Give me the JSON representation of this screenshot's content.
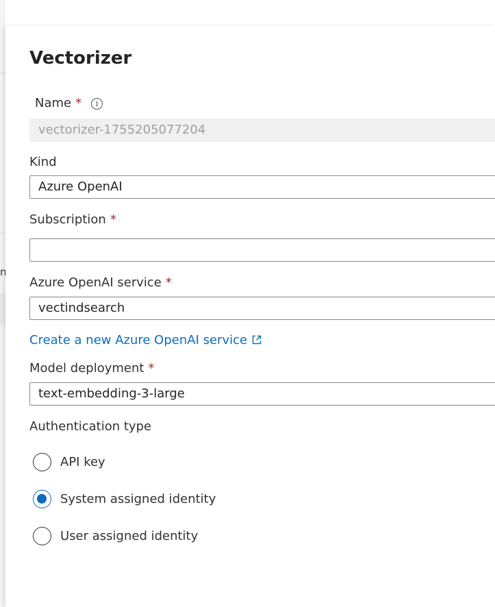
{
  "panel": {
    "title": "Vectorizer"
  },
  "fields": {
    "name": {
      "label": "Name",
      "required": "*",
      "value": "vectorizer-1755205077204"
    },
    "kind": {
      "label": "Kind",
      "value": "Azure OpenAI"
    },
    "subscription": {
      "label": "Subscription",
      "required": "*",
      "value": ""
    },
    "openai_service": {
      "label": "Azure OpenAI service",
      "required": "*",
      "value": "vectindsearch"
    },
    "create_link": "Create a new Azure OpenAI service",
    "model_deployment": {
      "label": "Model deployment",
      "required": "*",
      "value": "text-embedding-3-large"
    }
  },
  "authentication": {
    "label": "Authentication type",
    "options": [
      {
        "label": "API key",
        "checked": false
      },
      {
        "label": "System assigned identity",
        "checked": true
      },
      {
        "label": "User assigned identity",
        "checked": false
      }
    ]
  },
  "background": {
    "fragment": "n"
  },
  "colors": {
    "accent": "#0f6cbd",
    "required": "#a4262c",
    "disabled_bg": "#f0f0f0"
  },
  "icons": [
    "info-icon",
    "external-link-icon"
  ]
}
